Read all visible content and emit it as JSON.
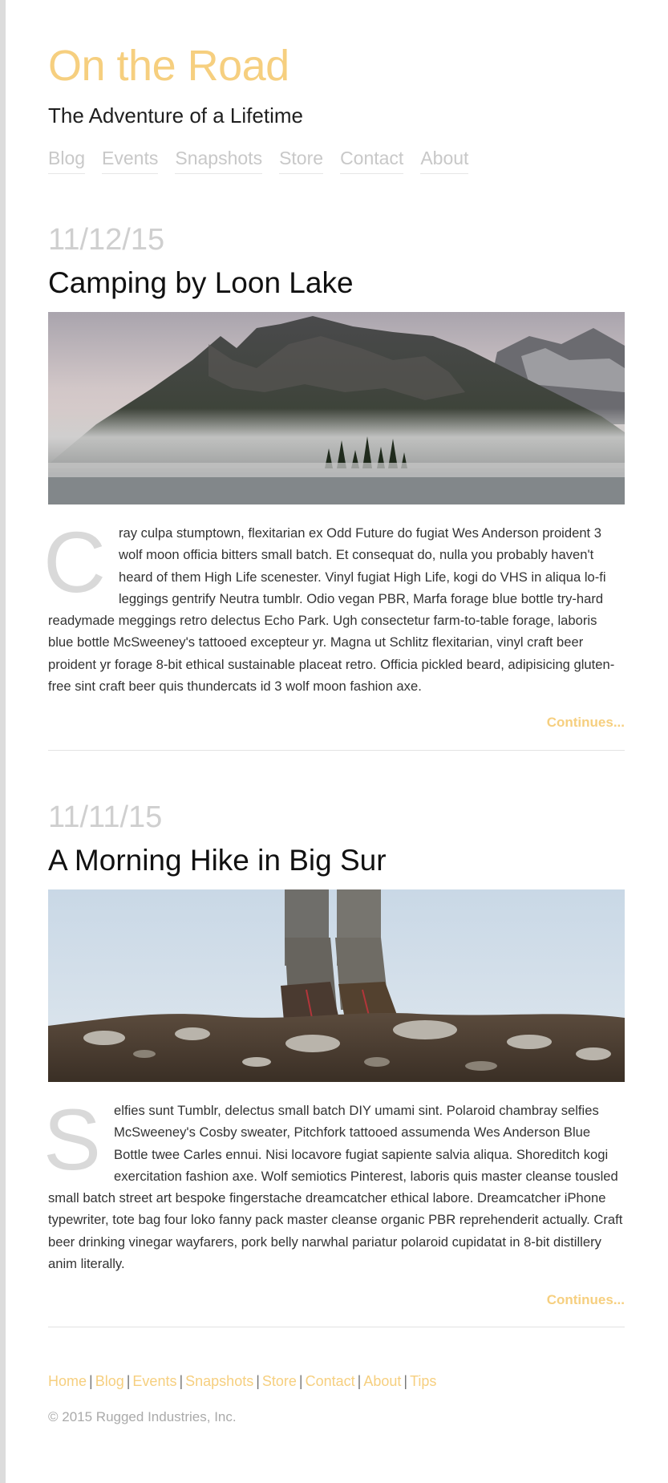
{
  "site": {
    "title": "On the Road",
    "tagline": "The Adventure of a Lifetime",
    "accent_color": "#f6cf7f"
  },
  "nav": [
    "Blog",
    "Events",
    "Snapshots",
    "Store",
    "Contact",
    "About"
  ],
  "posts": [
    {
      "date": "11/12/15",
      "title": "Camping by Loon Lake",
      "image": "misty-mountain-lake-photo",
      "drop_cap": "C",
      "body": "ray culpa stumptown, flexitarian ex Odd Future do fugiat Wes Anderson proident 3 wolf moon officia bitters small batch. Et consequat do, nulla you probably haven't heard of them High Life scenester. Vinyl fugiat High Life, kogi do VHS in aliqua lo-fi leggings gentrify Neutra tumblr. Odio vegan PBR, Marfa forage blue bottle try-hard readymade meggings retro delectus Echo Park. Ugh consectetur farm-to-table forage, laboris blue bottle McSweeney's tattooed excepteur yr. Magna ut Schlitz flexitarian, vinyl craft beer proident yr forage 8-bit ethical sustainable placeat retro. Officia pickled beard, adipisicing gluten-free sint craft beer quis thundercats id 3 wolf moon fashion axe.",
      "more": "Continues..."
    },
    {
      "date": "11/11/15",
      "title": "A Morning Hike in Big Sur",
      "image": "hiking-boots-on-rocks-photo",
      "drop_cap": "S",
      "body": "elfies sunt Tumblr, delectus small batch DIY umami sint. Polaroid chambray selfies McSweeney's Cosby sweater, Pitchfork tattooed assumenda Wes Anderson Blue Bottle twee Carles ennui. Nisi locavore fugiat sapiente salvia aliqua. Shoreditch kogi exercitation fashion axe. Wolf semiotics Pinterest, laboris quis master cleanse tousled small batch street art bespoke fingerstache dreamcatcher ethical labore. Dreamcatcher iPhone typewriter, tote bag four loko fanny pack master cleanse organic PBR reprehenderit actually. Craft beer drinking vinegar wayfarers, pork belly narwhal pariatur polaroid cupidatat in 8-bit distillery anim literally.",
      "more": "Continues..."
    }
  ],
  "footer": {
    "links": [
      "Home",
      "Blog",
      "Events",
      "Snapshots",
      "Store",
      "Contact",
      "About",
      "Tips"
    ],
    "copyright": "© 2015 Rugged Industries, Inc."
  }
}
